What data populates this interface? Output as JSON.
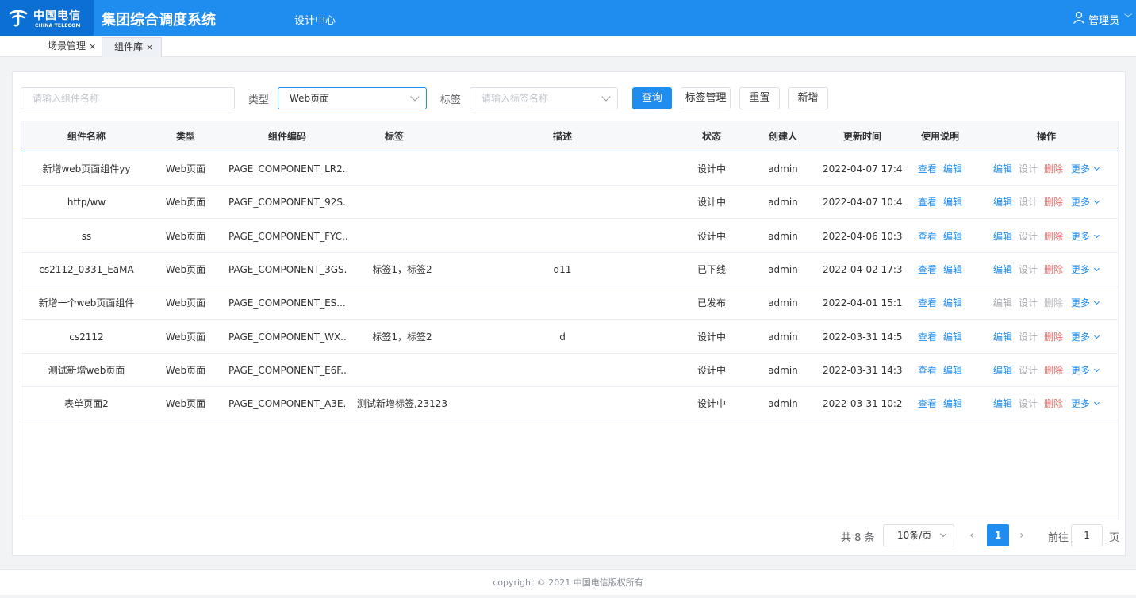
{
  "header": {
    "logo_cn": "中国电信",
    "logo_en": "CHINA TELECOM",
    "app_title": "集团综合调度系统",
    "nav_item": "设计中心",
    "user_name": "管理员"
  },
  "tabs": [
    {
      "label": "场景管理",
      "close": "×",
      "active": false
    },
    {
      "label": "组件库",
      "close": "×",
      "active": true
    }
  ],
  "filter": {
    "name_placeholder": "请输入组件名称",
    "type_label": "类型",
    "type_value": "Web页面",
    "tag_label": "标签",
    "tag_placeholder": "请输入标签名称",
    "query_btn": "查询",
    "tag_manage_btn": "标签管理",
    "reset_btn": "重置",
    "add_btn": "新增"
  },
  "table": {
    "headers": [
      "组件名称",
      "类型",
      "组件编码",
      "标签",
      "描述",
      "状态",
      "创建人",
      "更新时间",
      "使用说明",
      "操作"
    ],
    "doc_actions": {
      "view": "查看",
      "edit": "编辑"
    },
    "op_actions": {
      "edit": "编辑",
      "design": "设计",
      "delete": "删除",
      "more": "更多"
    },
    "rows": [
      {
        "name": "新增web页面组件yy",
        "type": "Web页面",
        "code": "PAGE_COMPONENT_LR2...",
        "tags": "",
        "desc": "",
        "status": "设计中",
        "creator": "admin",
        "updated": "2022-04-07 17:4...",
        "locked": false
      },
      {
        "name": "http/ww",
        "type": "Web页面",
        "code": "PAGE_COMPONENT_92S...",
        "tags": "",
        "desc": "",
        "status": "设计中",
        "creator": "admin",
        "updated": "2022-04-07 10:4...",
        "locked": false
      },
      {
        "name": "ss",
        "type": "Web页面",
        "code": "PAGE_COMPONENT_FYC...",
        "tags": "",
        "desc": "",
        "status": "设计中",
        "creator": "admin",
        "updated": "2022-04-06 10:3...",
        "locked": false
      },
      {
        "name": "cs2112_0331_EaMA",
        "type": "Web页面",
        "code": "PAGE_COMPONENT_3GS...",
        "tags": "标签1，标签2",
        "desc": "d11",
        "status": "已下线",
        "creator": "admin",
        "updated": "2022-04-02 17:3...",
        "locked": false
      },
      {
        "name": "新增一个web页面组件",
        "type": "Web页面",
        "code": "PAGE_COMPONENT_ES...",
        "tags": "",
        "desc": "",
        "status": "已发布",
        "creator": "admin",
        "updated": "2022-04-01 15:1...",
        "locked": true
      },
      {
        "name": "cs2112",
        "type": "Web页面",
        "code": "PAGE_COMPONENT_WX...",
        "tags": "标签1，标签2",
        "desc": "d",
        "status": "设计中",
        "creator": "admin",
        "updated": "2022-03-31 14:5...",
        "locked": false
      },
      {
        "name": "测试新增web页面",
        "type": "Web页面",
        "code": "PAGE_COMPONENT_E6F...",
        "tags": "",
        "desc": "",
        "status": "设计中",
        "creator": "admin",
        "updated": "2022-03-31 14:3...",
        "locked": false
      },
      {
        "name": "表单页面2",
        "type": "Web页面",
        "code": "PAGE_COMPONENT_A3E...",
        "tags": "测试新增标签,23123",
        "desc": "",
        "status": "设计中",
        "creator": "admin",
        "updated": "2022-03-31 10:2...",
        "locked": false
      }
    ]
  },
  "pagination": {
    "total": "共 8 条",
    "page_size": "10条/页",
    "prev": "‹",
    "current": "1",
    "next": "›",
    "goto_label": "前往",
    "goto_value": "1",
    "page_suffix": "页"
  },
  "footer": {
    "copyright": "copyright © 2021 中国电信版权所有"
  },
  "colors": {
    "primary": "#1f8cf0",
    "header_dark": "#0b6fd3",
    "danger": "#f56c6c"
  }
}
